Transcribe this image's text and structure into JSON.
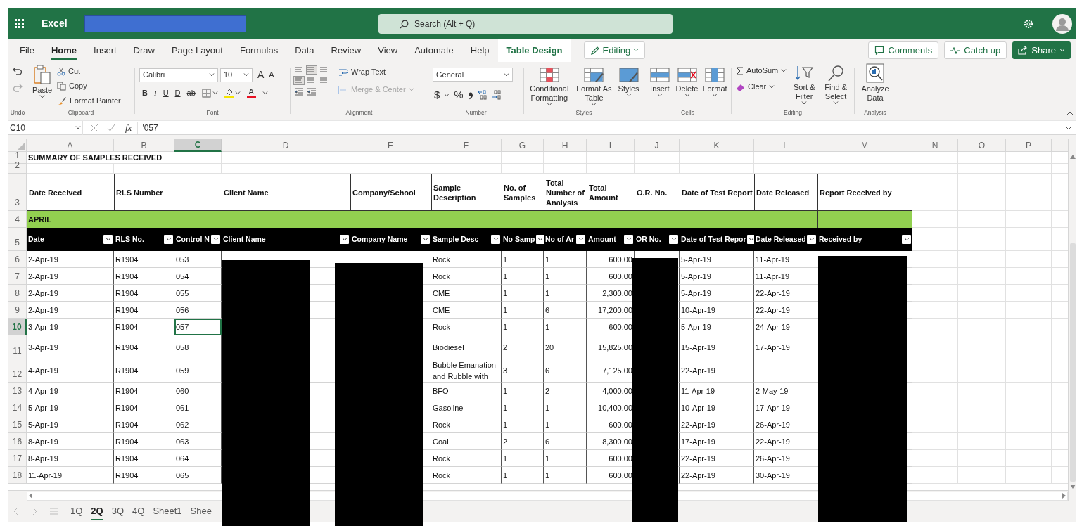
{
  "title_bar": {
    "app_name": "Excel",
    "filename_redacted": true,
    "search_placeholder": "Search (Alt + Q)"
  },
  "menu_tabs": [
    {
      "label": "File",
      "selected": false,
      "kind": "standard"
    },
    {
      "label": "Home",
      "selected": true,
      "kind": "standard"
    },
    {
      "label": "Insert",
      "selected": false,
      "kind": "standard"
    },
    {
      "label": "Draw",
      "selected": false,
      "kind": "standard"
    },
    {
      "label": "Page Layout",
      "selected": false,
      "kind": "standard"
    },
    {
      "label": "Formulas",
      "selected": false,
      "kind": "standard"
    },
    {
      "label": "Data",
      "selected": false,
      "kind": "standard"
    },
    {
      "label": "Review",
      "selected": false,
      "kind": "standard"
    },
    {
      "label": "View",
      "selected": false,
      "kind": "standard"
    },
    {
      "label": "Automate",
      "selected": false,
      "kind": "standard"
    },
    {
      "label": "Help",
      "selected": false,
      "kind": "standard"
    },
    {
      "label": "Table Design",
      "selected": false,
      "kind": "contextual"
    }
  ],
  "mode_button": "Editing",
  "action_buttons": [
    {
      "label": "Comments",
      "kind": "outline"
    },
    {
      "label": "Catch up",
      "kind": "outline"
    },
    {
      "label": "Share",
      "kind": "primary"
    }
  ],
  "ribbon": {
    "undo": {
      "label": "Undo"
    },
    "clipboard": {
      "label": "Clipboard",
      "paste": "Paste",
      "cut": "Cut",
      "copy": "Copy",
      "format_painter": "Format Painter"
    },
    "font": {
      "label": "Font",
      "font_name": "Calibri",
      "font_size": "10",
      "grow": "A",
      "shrink": "A",
      "bold": "B",
      "italic": "I",
      "underline": "U",
      "double_underline": "D",
      "strikethrough": "ab",
      "font_color": "A"
    },
    "alignment": {
      "label": "Alignment",
      "wrap_text": "Wrap Text",
      "merge_center": "Merge & Center",
      "merge_disabled": true
    },
    "number": {
      "label": "Number",
      "format": "General",
      "currency": "$",
      "percent": "%"
    },
    "styles": {
      "label": "Styles",
      "conditional_formatting": "Conditional Formatting",
      "format_as_table": "Format As Table",
      "cell_styles": "Styles"
    },
    "cells": {
      "label": "Cells",
      "insert": "Insert",
      "delete": "Delete",
      "format": "Format"
    },
    "editing": {
      "label": "Editing",
      "autosum": "AutoSum",
      "clear": "Clear",
      "sort_filter": "Sort & Filter",
      "find_select": "Find & Select"
    },
    "analysis": {
      "label": "Analysis",
      "analyze_data": "Analyze Data"
    }
  },
  "formula_bar": {
    "cell_ref": "C10",
    "function_label": "fx",
    "formula": "'057"
  },
  "sheet": {
    "columns": [
      {
        "letter": "A",
        "selected": false,
        "redacted": false
      },
      {
        "letter": "B",
        "selected": false,
        "redacted": false
      },
      {
        "letter": "C",
        "selected": true,
        "redacted": false
      },
      {
        "letter": "D",
        "selected": false,
        "redacted": true
      },
      {
        "letter": "E",
        "selected": false,
        "redacted": true
      },
      {
        "letter": "F",
        "selected": false,
        "redacted": false
      },
      {
        "letter": "G",
        "selected": false,
        "redacted": false
      },
      {
        "letter": "H",
        "selected": false,
        "redacted": false
      },
      {
        "letter": "I",
        "selected": false,
        "redacted": false
      },
      {
        "letter": "J",
        "selected": false,
        "redacted": true
      },
      {
        "letter": "K",
        "selected": false,
        "redacted": false
      },
      {
        "letter": "L",
        "selected": false,
        "redacted": false
      },
      {
        "letter": "M",
        "selected": false,
        "redacted": true
      },
      {
        "letter": "N",
        "selected": false,
        "redacted": false
      },
      {
        "letter": "O",
        "selected": false,
        "redacted": false
      },
      {
        "letter": "P",
        "selected": false,
        "redacted": false
      }
    ],
    "rows": [
      {
        "number": "1",
        "kind": "title",
        "selected": false,
        "cells": {
          "A": "SUMMARY OF SAMPLES RECEIVED"
        }
      },
      {
        "number": "2",
        "kind": "blank",
        "selected": false
      },
      {
        "number": "3",
        "kind": "header",
        "selected": false,
        "cells": {
          "A": "Date Received",
          "B": "RLS Number",
          "D": "Client Name",
          "E": "Company/School",
          "F": "Sample Description",
          "G": "No. of Samples",
          "H": "Total Number of Analysis",
          "I": "Total Amount",
          "J": "O.R. No.",
          "K": "Date of Test Report",
          "L": "Date Released",
          "M": "Report Received by"
        }
      },
      {
        "number": "4",
        "kind": "band",
        "selected": false,
        "cells": {
          "A": "APRIL"
        }
      },
      {
        "number": "5",
        "kind": "table_header",
        "selected": false,
        "cells": {
          "A": "Date",
          "B": "RLS No.",
          "C": "Control N",
          "D": "Client Name",
          "E": "Company Name",
          "F": "Sample Desc",
          "G": "No Samp",
          "H": "No of Ar",
          "I": "Amount",
          "J": "OR No.",
          "K": "Date of Test Repor",
          "L": "Date Released",
          "M": "Received by"
        }
      },
      {
        "number": "6",
        "kind": "data",
        "selected": false,
        "cells": {
          "A": "2-Apr-19",
          "B": "R1904",
          "C": "053",
          "F": "Rock",
          "G": "1",
          "H": "1",
          "I": "600.00",
          "K": "5-Apr-19",
          "L": "11-Apr-19"
        }
      },
      {
        "number": "7",
        "kind": "data",
        "selected": false,
        "cells": {
          "A": "2-Apr-19",
          "B": "R1904",
          "C": "054",
          "F": "Rock",
          "G": "1",
          "H": "1",
          "I": "600.00",
          "K": "5-Apr-19",
          "L": "11-Apr-19"
        }
      },
      {
        "number": "8",
        "kind": "data",
        "selected": false,
        "cells": {
          "A": "2-Apr-19",
          "B": "R1904",
          "C": "055",
          "F": "CME",
          "G": "1",
          "H": "1",
          "I": "2,300.00",
          "K": "5-Apr-19",
          "L": "22-Apr-19"
        }
      },
      {
        "number": "9",
        "kind": "data",
        "selected": false,
        "cells": {
          "A": "2-Apr-19",
          "B": "R1904",
          "C": "056",
          "F": "CME",
          "G": "1",
          "H": "6",
          "I": "17,200.00",
          "K": "10-Apr-19",
          "L": "22-Apr-19"
        }
      },
      {
        "number": "10",
        "kind": "data",
        "selected": true,
        "cells": {
          "A": "3-Apr-19",
          "B": "R1904",
          "C": "057",
          "F": "Rock",
          "G": "1",
          "H": "1",
          "I": "600.00",
          "K": "5-Apr-19",
          "L": "24-Apr-19"
        }
      },
      {
        "number": "11",
        "kind": "data",
        "selected": false,
        "cells": {
          "A": "3-Apr-19",
          "B": "R1904",
          "C": "058",
          "F": "Biodiesel",
          "G": "2",
          "H": "20",
          "I": "15,825.00",
          "K": "15-Apr-19",
          "L": "17-Apr-19"
        }
      },
      {
        "number": "12",
        "kind": "data",
        "selected": false,
        "cells": {
          "A": "4-Apr-19",
          "B": "R1904",
          "C": "059",
          "F": "Bubble Emanation and Rubble with",
          "G": "3",
          "H": "6",
          "I": "7,125.00",
          "K": "22-Apr-19"
        }
      },
      {
        "number": "13",
        "kind": "data",
        "selected": false,
        "cells": {
          "A": "4-Apr-19",
          "B": "R1904",
          "C": "060",
          "F": "BFO",
          "G": "1",
          "H": "2",
          "I": "4,000.00",
          "K": "11-Apr-19",
          "L": "2-May-19"
        }
      },
      {
        "number": "14",
        "kind": "data",
        "selected": false,
        "cells": {
          "A": "5-Apr-19",
          "B": "R1904",
          "C": "061",
          "F": "Gasoline",
          "G": "1",
          "H": "1",
          "I": "10,400.00",
          "K": "10-Apr-19",
          "L": "17-Apr-19"
        }
      },
      {
        "number": "15",
        "kind": "data",
        "selected": false,
        "cells": {
          "A": "5-Apr-19",
          "B": "R1904",
          "C": "062",
          "F": "Rock",
          "G": "1",
          "H": "1",
          "I": "600.00",
          "K": "22-Apr-19",
          "L": "26-Apr-19"
        }
      },
      {
        "number": "16",
        "kind": "data",
        "selected": false,
        "cells": {
          "A": "8-Apr-19",
          "B": "R1904",
          "C": "063",
          "F": "Coal",
          "G": "2",
          "H": "6",
          "I": "8,300.00",
          "K": "17-Apr-19",
          "L": "22-Apr-19"
        }
      },
      {
        "number": "17",
        "kind": "data",
        "selected": false,
        "cells": {
          "A": "8-Apr-19",
          "B": "R1904",
          "C": "064",
          "F": "Rock",
          "G": "1",
          "H": "1",
          "I": "600.00",
          "K": "22-Apr-19",
          "L": "26-Apr-19"
        }
      },
      {
        "number": "18",
        "kind": "data",
        "selected": false,
        "cells": {
          "A": "11-Apr-19",
          "B": "R1904",
          "C": "065",
          "F": "Rock",
          "G": "1",
          "H": "1",
          "I": "600.00",
          "K": "22-Apr-19",
          "L": "30-Apr-19"
        }
      }
    ]
  },
  "sheet_tabs": [
    {
      "label": "1Q",
      "selected": false
    },
    {
      "label": "2Q",
      "selected": true
    },
    {
      "label": "3Q",
      "selected": false
    },
    {
      "label": "4Q",
      "selected": false
    },
    {
      "label": "Sheet1",
      "selected": false
    },
    {
      "label": "Shee",
      "selected": false
    }
  ]
}
